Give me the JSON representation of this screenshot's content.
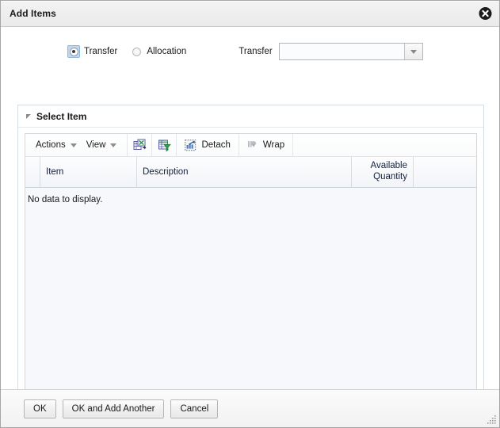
{
  "window": {
    "title": "Add Items",
    "close_icon": "close-circle-icon",
    "resize_icon": "resize-grip-icon"
  },
  "form": {
    "radios": [
      {
        "label": "Transfer",
        "selected": true
      },
      {
        "label": "Allocation",
        "selected": false
      }
    ],
    "field": {
      "label": "Transfer",
      "value": "",
      "placeholder": "",
      "dropdown_icon": "chevron-down-icon"
    }
  },
  "panel": {
    "title": "Select Item",
    "disclosure_icon": "disclosure-expanded-icon",
    "toolbar": {
      "actions_label": "Actions",
      "view_label": "View",
      "caret_icon": "caret-down-icon",
      "icon_buttons": [
        {
          "name": "export-to-excel-icon",
          "title": "Export to Excel"
        },
        {
          "name": "query-by-example-icon",
          "title": "Query By Example"
        }
      ],
      "detach_label": "Detach",
      "detach_icon": "detach-icon",
      "wrap_label": "Wrap",
      "wrap_icon": "wrap-icon"
    },
    "table": {
      "columns": [
        {
          "key": "item",
          "label": "Item",
          "align": "left"
        },
        {
          "key": "description",
          "label": "Description",
          "align": "left"
        },
        {
          "key": "available_quantity",
          "label": "Available Quantity",
          "align": "right"
        }
      ],
      "rows": [],
      "empty_text": "No data to display."
    }
  },
  "footer": {
    "buttons": [
      {
        "label": "OK",
        "name": "ok-button"
      },
      {
        "label": "OK and Add Another",
        "name": "ok-and-add-another-button"
      },
      {
        "label": "Cancel",
        "name": "cancel-button"
      }
    ]
  },
  "colors": {
    "titlebar": "#efeeee",
    "panel_border": "#d6dde3",
    "table_body": "#f7f8fc",
    "header_text": "#11203a",
    "radio_focus": "#bfd9f2"
  }
}
